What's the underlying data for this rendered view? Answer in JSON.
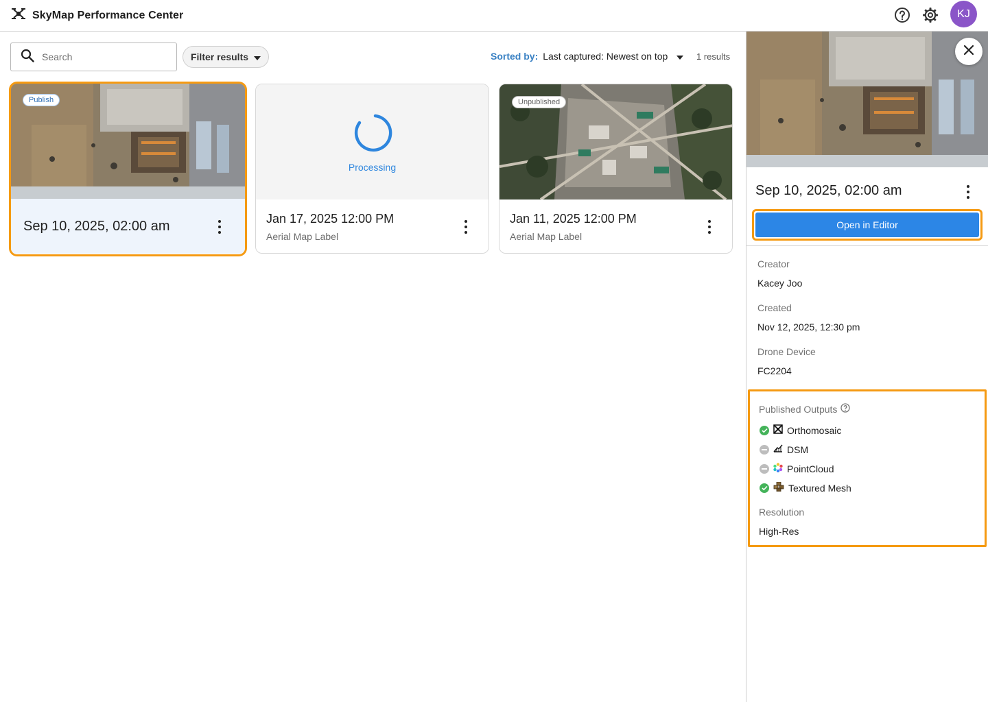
{
  "app": {
    "title": "SkyMap Performance Center",
    "user_initials": "KJ",
    "avatar_color": "#8a55c8"
  },
  "toolbar": {
    "search_placeholder": "Search",
    "filter_label": "Filter results",
    "sort_label": "Sorted by:",
    "sort_value": "Last captured: Newest on top",
    "results_count": "1 results"
  },
  "cards": [
    {
      "status": "Publish",
      "title": "Sep 10, 2025, 02:00 am",
      "subtitle": ""
    },
    {
      "status": "Processing",
      "title": "Jan 17, 2025 12:00 PM",
      "subtitle": "Aerial Map Label"
    },
    {
      "status": "Unpublished",
      "title": "Jan 11, 2025 12:00 PM",
      "subtitle": "Aerial Map Label"
    }
  ],
  "panel": {
    "title": "Sep 10, 2025, 02:00 am",
    "open_button": "Open in Editor",
    "fields": [
      {
        "label": "Creator",
        "value": "Kacey Joo"
      },
      {
        "label": "Created",
        "value": "Nov 12, 2025, 12:30 pm"
      },
      {
        "label": "Drone Device",
        "value": "FC2204"
      }
    ],
    "outputs_label": "Published Outputs",
    "outputs": [
      {
        "name": "Orthomosaic",
        "published": true,
        "icon": "orthomosaic-icon"
      },
      {
        "name": "DSM",
        "published": false,
        "icon": "dsm-icon"
      },
      {
        "name": "PointCloud",
        "published": false,
        "icon": "pointcloud-icon"
      },
      {
        "name": "Textured Mesh",
        "published": true,
        "icon": "textured-mesh-icon"
      }
    ],
    "resolution_label": "Resolution",
    "resolution_value": "High-Res"
  },
  "colors": {
    "accent": "#2c86e6",
    "highlight": "#f59a12",
    "published": "#44b35a",
    "unpublished": "#bdbdbd"
  }
}
